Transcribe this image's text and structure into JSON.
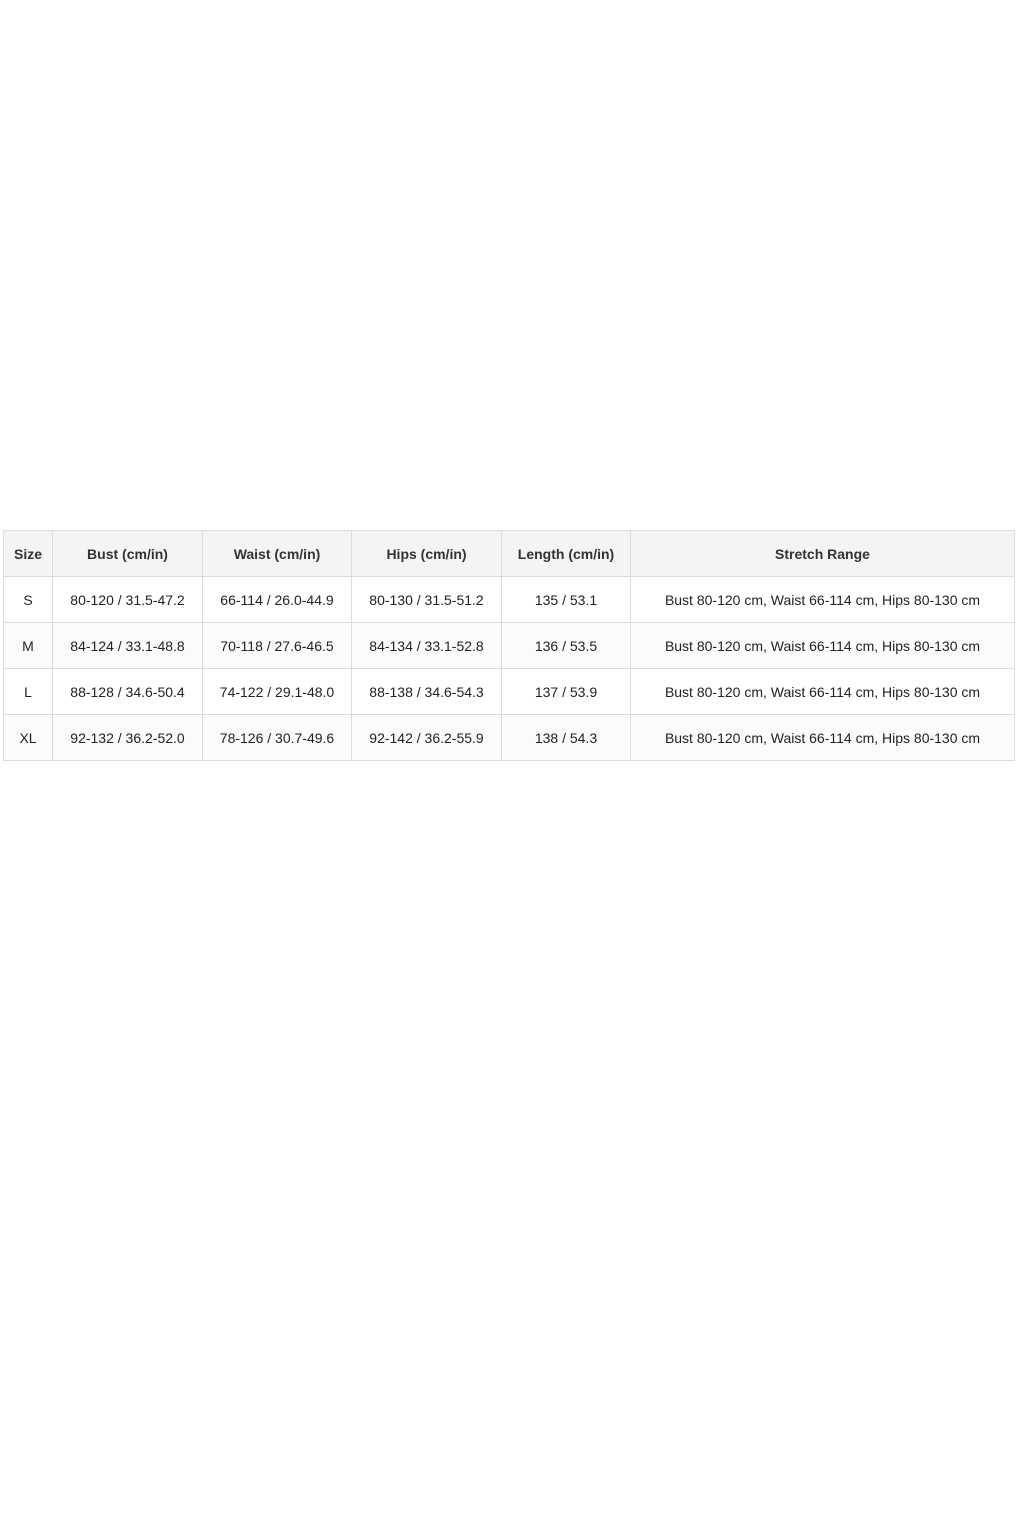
{
  "size_chart": {
    "headers": [
      "Size",
      "Bust (cm/in)",
      "Waist (cm/in)",
      "Hips (cm/in)",
      "Length (cm/in)",
      "Stretch Range"
    ],
    "rows": [
      [
        "S",
        "80-120 / 31.5-47.2",
        "66-114 / 26.0-44.9",
        "80-130 / 31.5-51.2",
        "135 / 53.1",
        "Bust 80-120 cm, Waist 66-114 cm, Hips 80-130 cm"
      ],
      [
        "M",
        "84-124 / 33.1-48.8",
        "70-118 / 27.6-46.5",
        "84-134 / 33.1-52.8",
        "136 / 53.5",
        "Bust 80-120 cm, Waist 66-114 cm, Hips 80-130 cm"
      ],
      [
        "L",
        "88-128 / 34.6-50.4",
        "74-122 / 29.1-48.0",
        "88-138 / 34.6-54.3",
        "137 / 53.9",
        "Bust 80-120 cm, Waist 66-114 cm, Hips 80-130 cm"
      ],
      [
        "XL",
        "92-132 / 36.2-52.0",
        "78-126 / 30.7-49.6",
        "92-142 / 36.2-55.9",
        "138 / 54.3",
        "Bust 80-120 cm, Waist 66-114 cm, Hips 80-130 cm"
      ]
    ]
  }
}
